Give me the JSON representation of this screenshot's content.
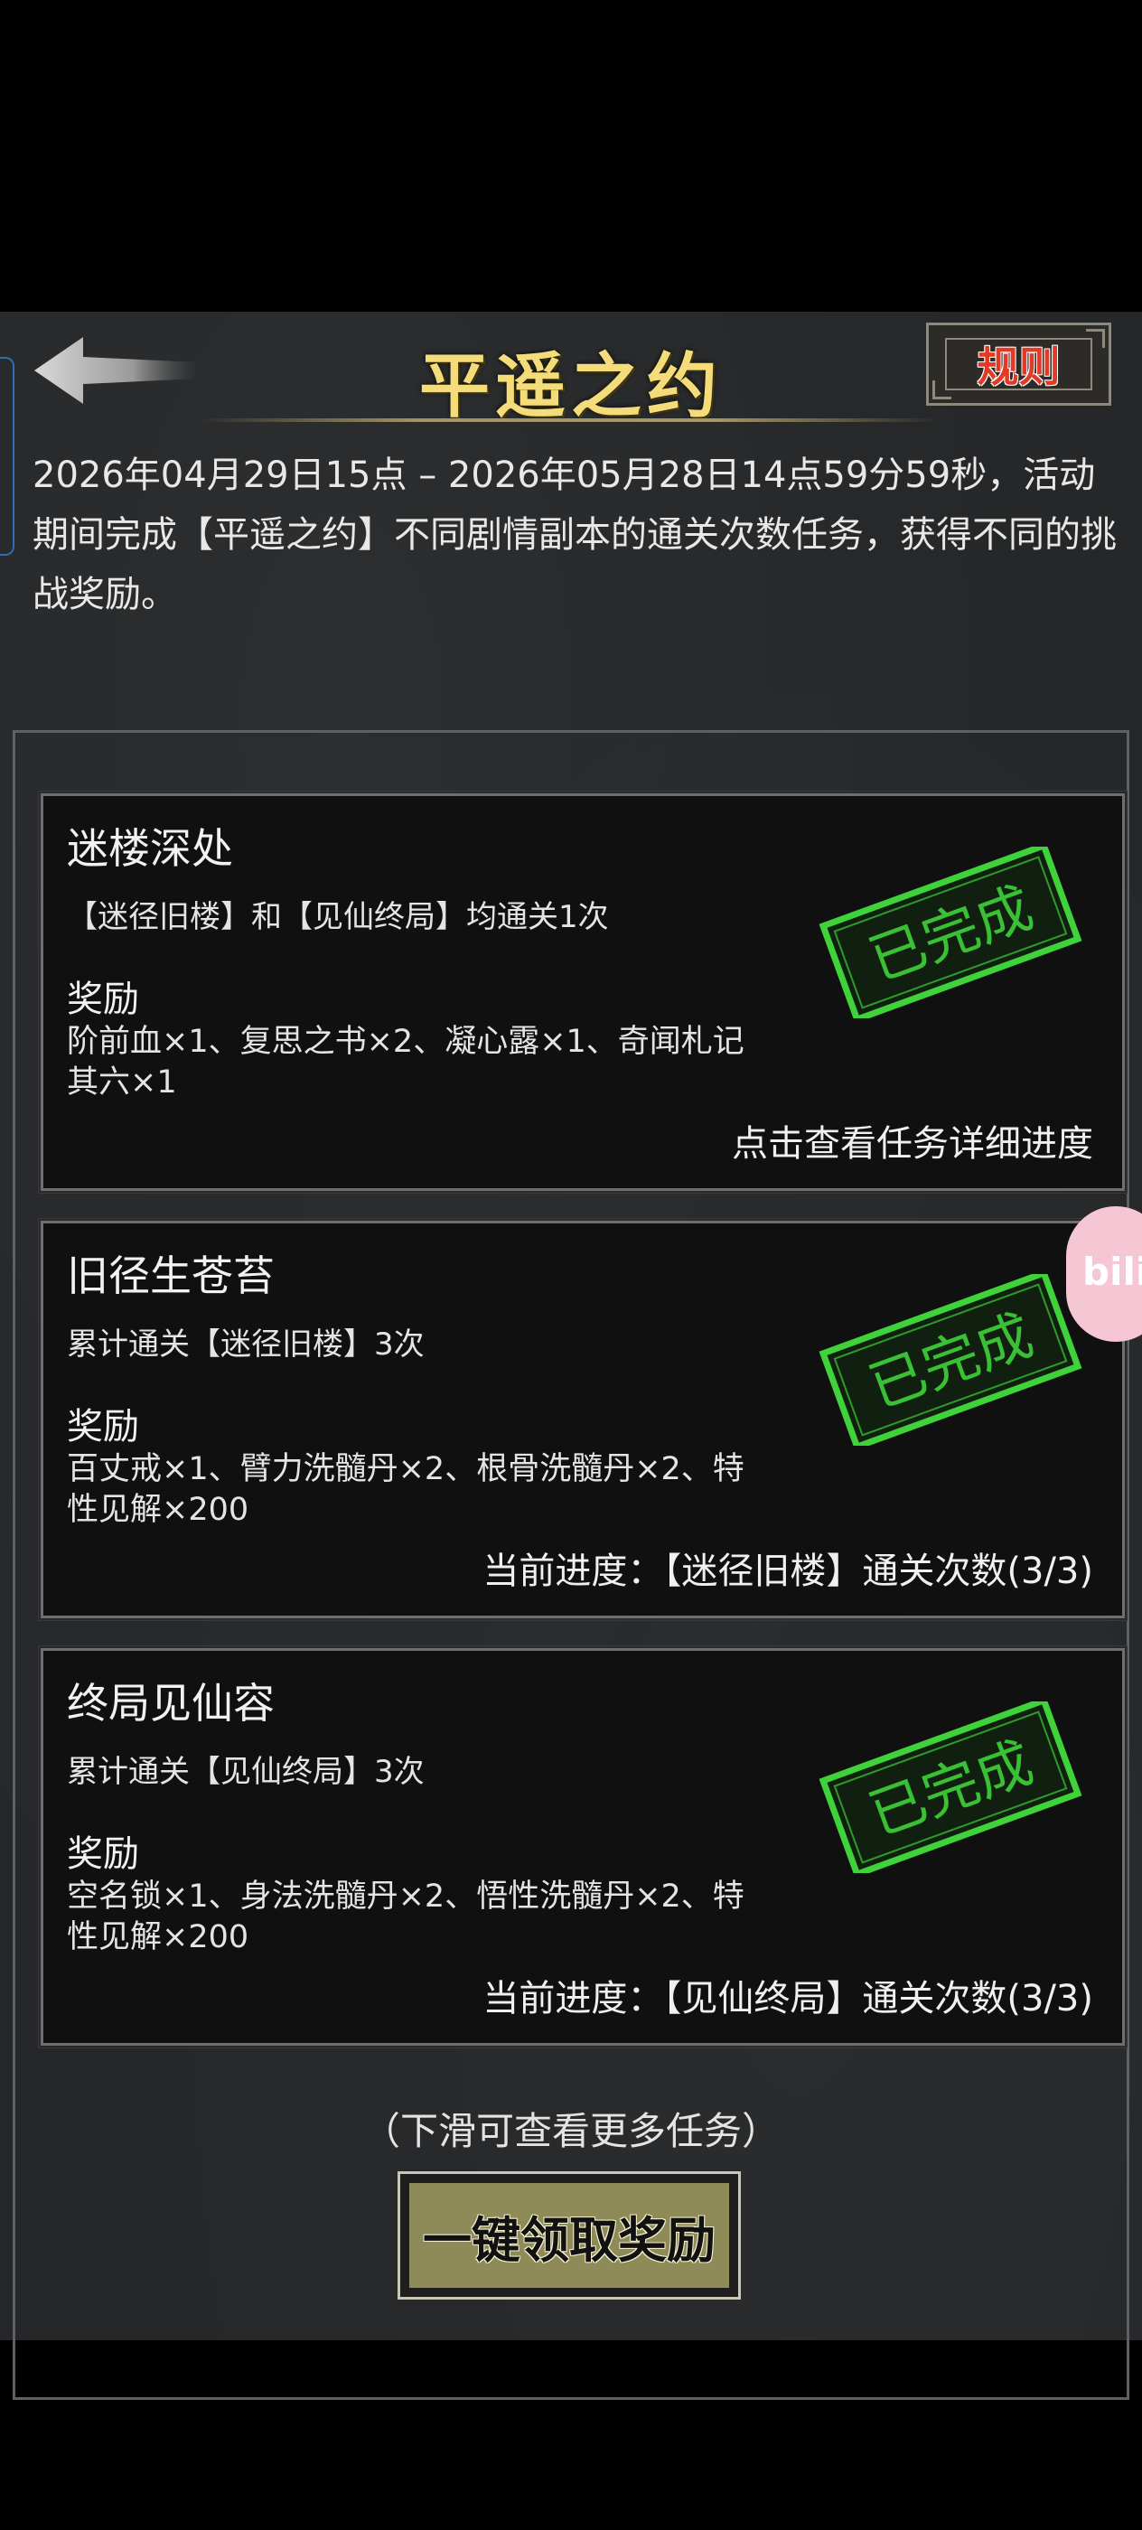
{
  "header": {
    "title": "平遥之约",
    "rules_label": "规则"
  },
  "description": "2026年04月29日15点 – 2026年05月28日14点59分59秒，活动期间完成【平遥之约】不同剧情副本的通关次数任务，获得不同的挑战奖励。",
  "tasks": [
    {
      "name": "迷楼深处",
      "requirement": "【迷径旧楼】和【见仙终局】均通关1次",
      "reward_label": "奖励",
      "rewards": "阶前血×1、复思之书×2、凝心露×1、奇闻札记其六×1",
      "footer": "点击查看任务详细进度",
      "stamp": "已完成"
    },
    {
      "name": "旧径生苍苔",
      "requirement": "累计通关【迷径旧楼】3次",
      "reward_label": "奖励",
      "rewards": "百丈戒×1、臂力洗髓丹×2、根骨洗髓丹×2、特性见解×200",
      "footer": "当前进度：【迷径旧楼】通关次数(3/3)",
      "stamp": "已完成"
    },
    {
      "name": "终局见仙容",
      "requirement": "累计通关【见仙终局】3次",
      "reward_label": "奖励",
      "rewards": "空名锁×1、身法洗髓丹×2、悟性洗髓丹×2、特性见解×200",
      "footer": "当前进度：【见仙终局】通关次数(3/3)",
      "stamp": "已完成"
    }
  ],
  "scroll_hint": "（下滑可查看更多任务）",
  "claim_button_label": "一键领取奖励",
  "overlay": {
    "bili_label": "bili"
  },
  "colors": {
    "title_gold": "#f4dc7a",
    "stamp_green": "#3fd23a",
    "rules_red": "#e23a26",
    "claim_button_bg": "#8f8b58"
  }
}
